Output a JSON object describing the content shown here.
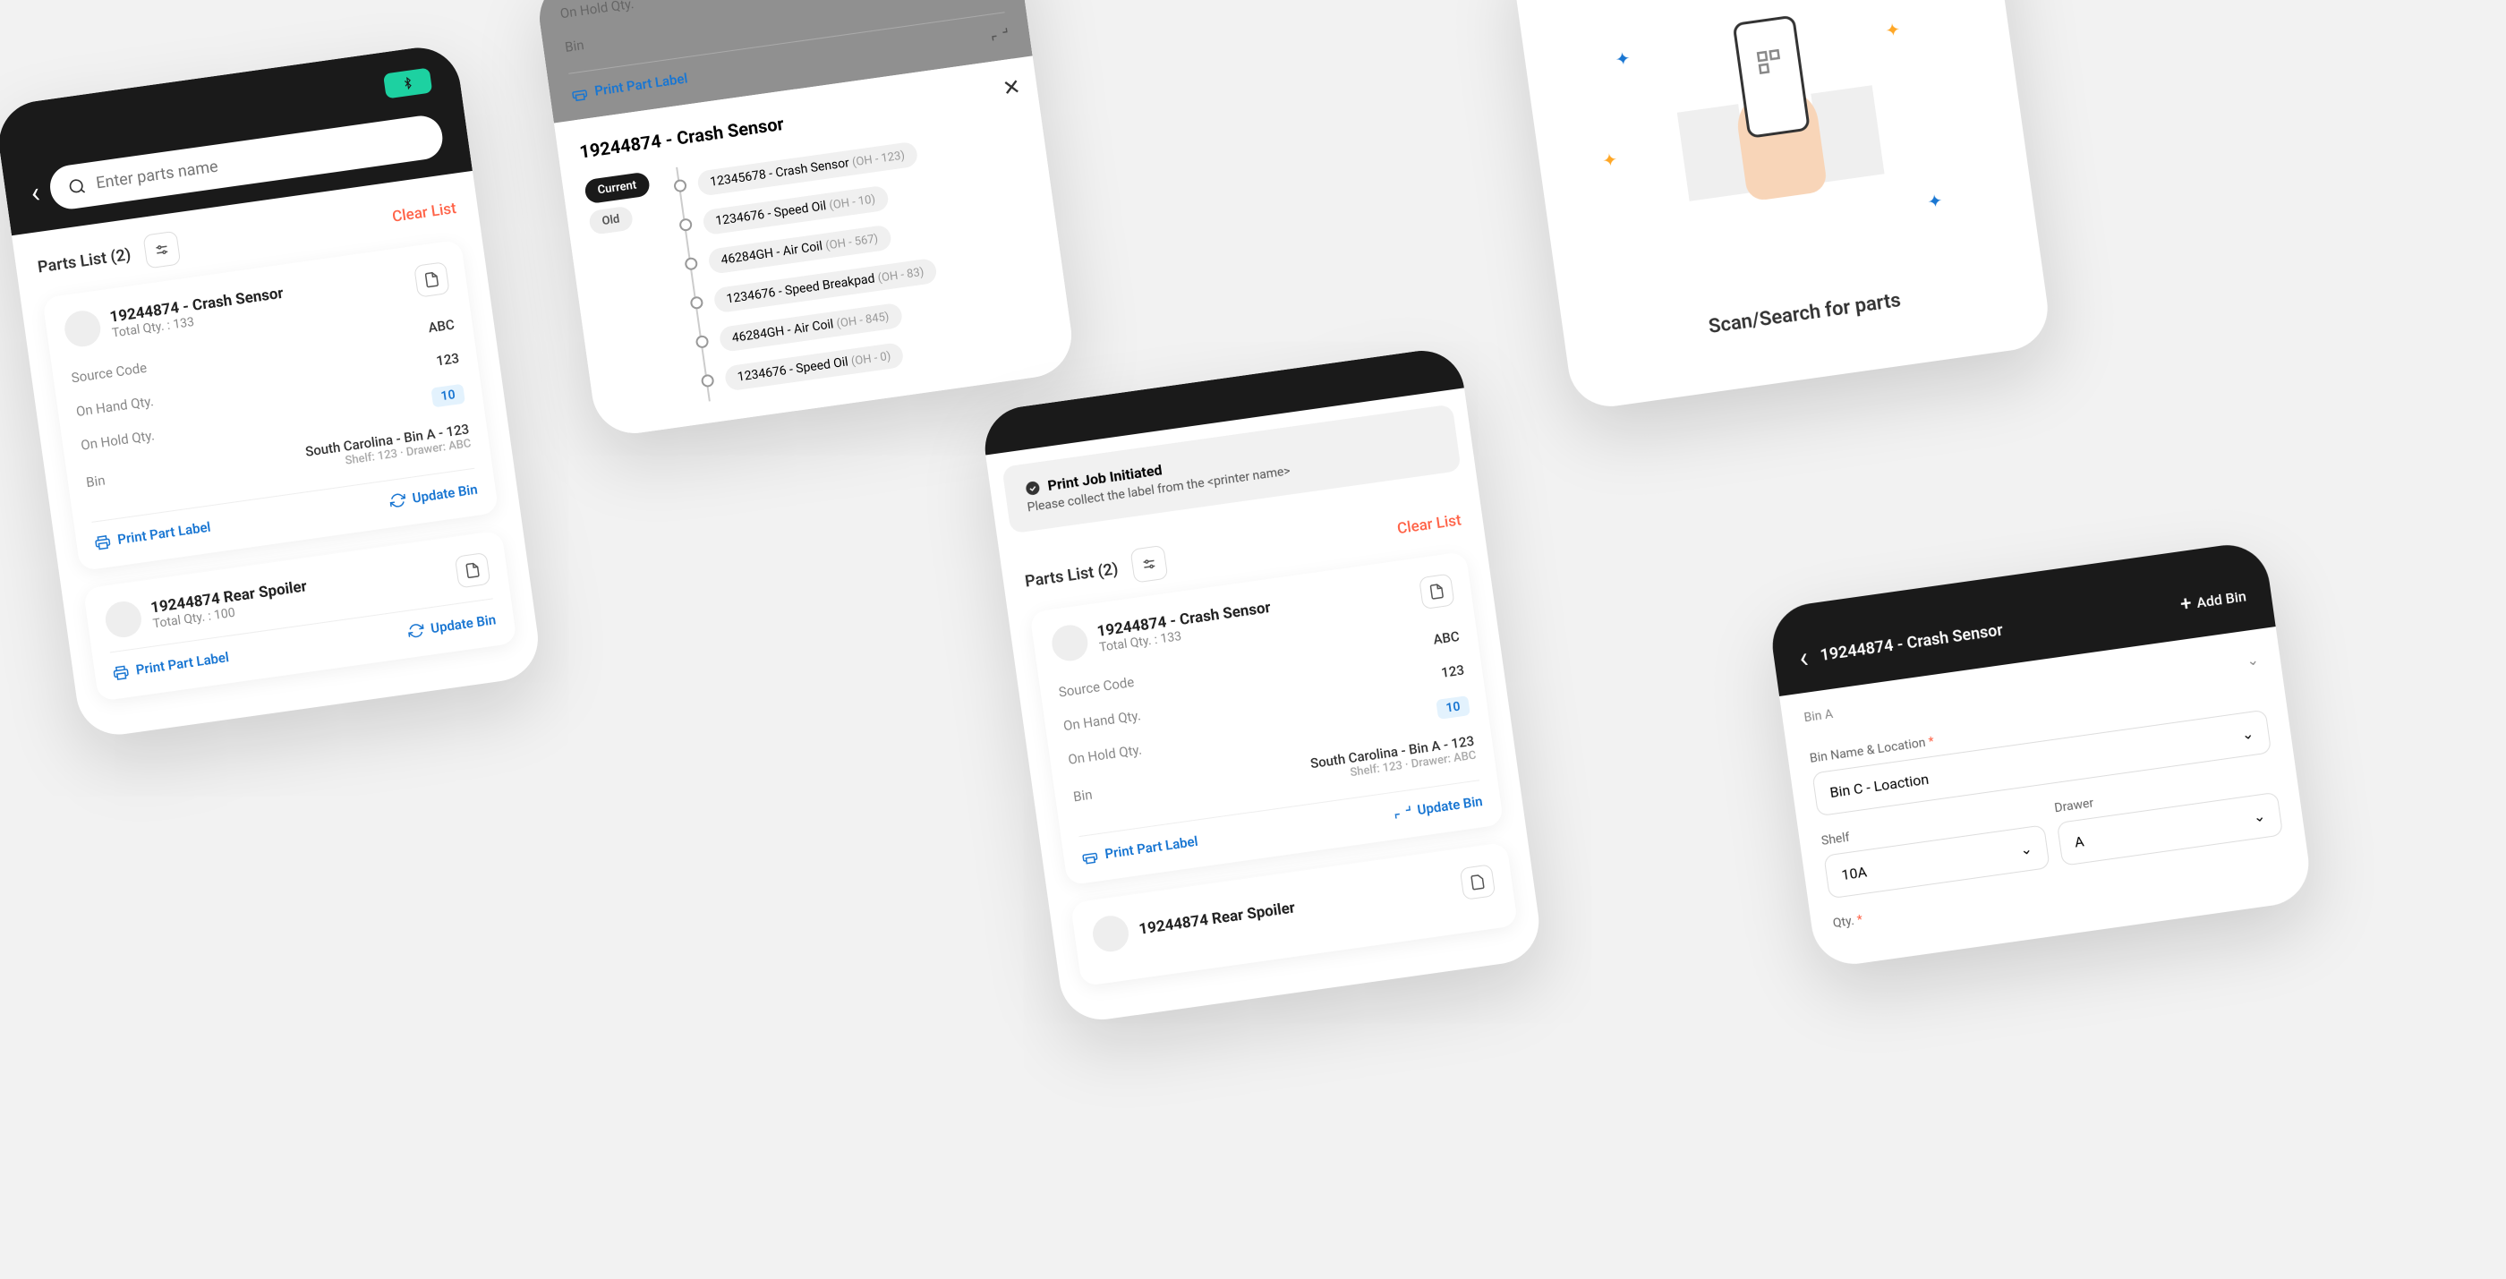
{
  "search": {
    "placeholder": "Enter parts name"
  },
  "partsList": {
    "label": "Parts List (2)",
    "clear": "Clear List"
  },
  "card1": {
    "title": "19244874 - Crash Sensor",
    "totalQty": "Total Qty. : 133",
    "source": {
      "label": "Source Code",
      "val": "ABC"
    },
    "onHand": {
      "label": "On Hand Qty.",
      "val": "123"
    },
    "onHold": {
      "label": "On Hold Qty.",
      "val": "10"
    },
    "bin": {
      "label": "Bin",
      "val": "South Carolina - Bin A - 123",
      "shelf": "Shelf: 123 · Drawer: ABC"
    },
    "print": "Print Part Label",
    "update": "Update Bin"
  },
  "card2": {
    "title": "19244874 Rear Spoiler",
    "totalQty": "Total Qty. : 100"
  },
  "drawer": {
    "title": "19244874 - Crash Sensor",
    "current": "Current",
    "old": "Old",
    "items": [
      {
        "name": "12345678 - Crash Sensor",
        "oh": "(OH - 123)"
      },
      {
        "name": "1234676 - Speed Oil",
        "oh": "(OH - 10)"
      },
      {
        "name": "46284GH - Air Coil",
        "oh": "(OH - 567)"
      },
      {
        "name": "1234676 - Speed Breakpad",
        "oh": "(OH - 83)"
      },
      {
        "name": "46284GH - Air Coil",
        "oh": "(OH - 845)"
      },
      {
        "name": "1234676 - Speed Oil",
        "oh": "(OH - 0)"
      }
    ]
  },
  "dimCard": {
    "onHold": "On Hold Qty.",
    "bin": "Bin",
    "print": "Print Part Label"
  },
  "toast": {
    "title": "Print Job Initiated",
    "msg": "Please collect the label from the <printer name>"
  },
  "scan": {
    "text": "Scan/Search for parts"
  },
  "addBin": {
    "headerTitle": "19244874 - Crash Sensor",
    "btn": "Add Bin",
    "binA": "Bin A",
    "binNameLabel": "Bin Name & Location",
    "binNameVal": "Bin C - Loaction",
    "shelfLabel": "Shelf",
    "shelfVal": "10A",
    "drawerLabel": "Drawer",
    "drawerVal": "A",
    "qtyLabel": "Qty."
  }
}
